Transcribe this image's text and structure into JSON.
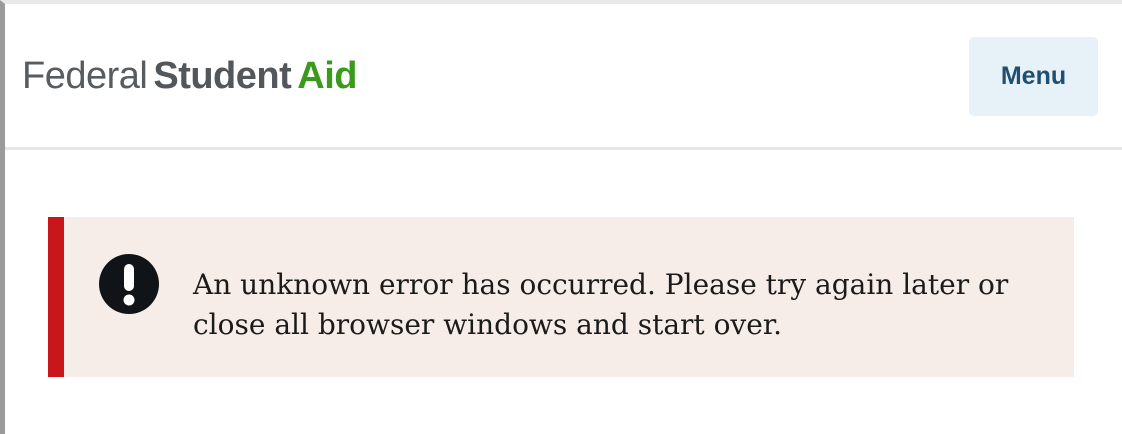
{
  "header": {
    "logo": {
      "part1": "Federal",
      "part2": "Student",
      "part3": "Aid"
    },
    "menu_label": "Menu"
  },
  "alert": {
    "icon": "exclamation-circle-icon",
    "message": "An unknown error has occurred. Please try again later or close all browser windows and start over."
  },
  "colors": {
    "accent_error": "#c9161b",
    "alert_background": "#f7ede8",
    "brand_green": "#3a9a1c",
    "menu_background": "#e6f1f8",
    "menu_text": "#1f4f73"
  }
}
